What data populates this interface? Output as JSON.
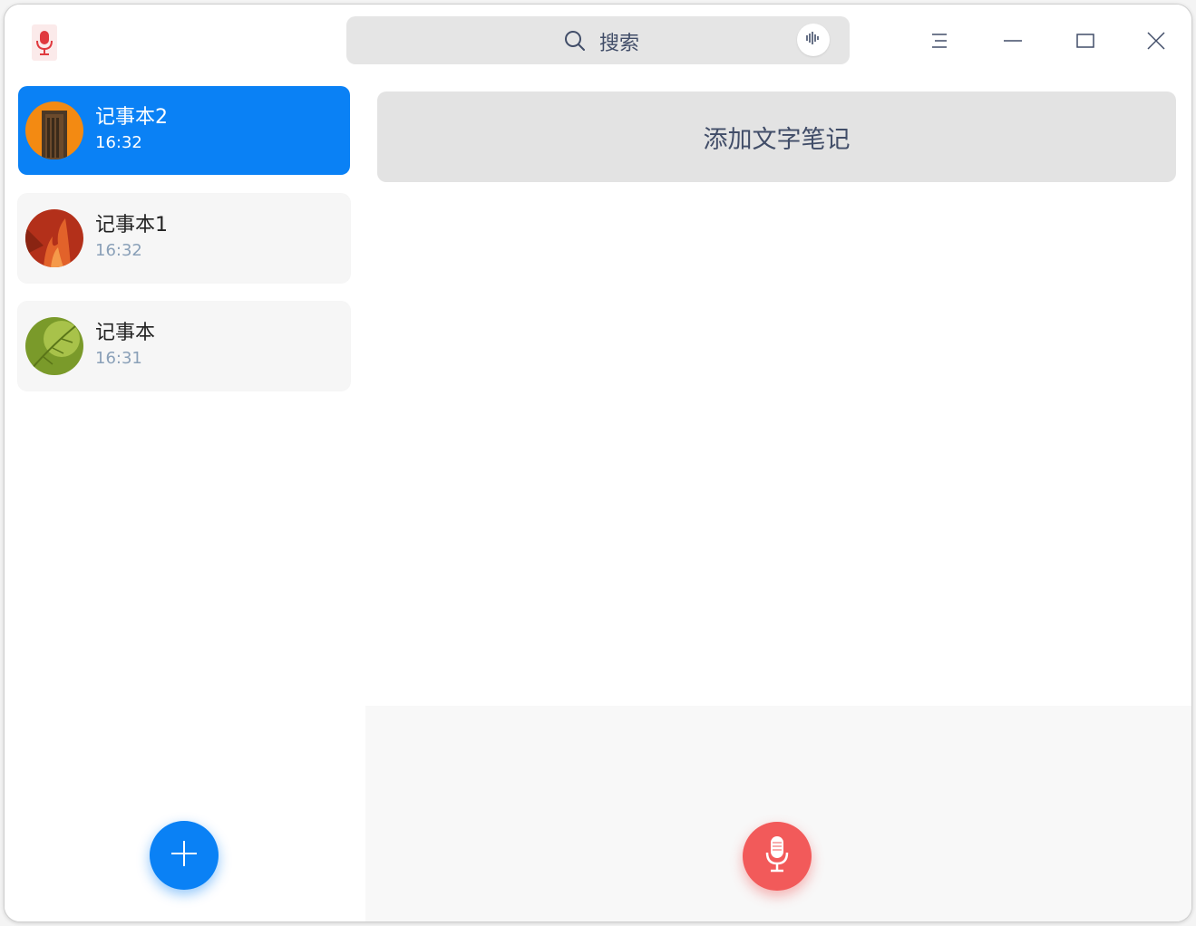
{
  "app": {
    "icon": "microphone-app-icon"
  },
  "search": {
    "placeholder": "搜索",
    "icon": "search-icon",
    "voice_icon": "waveform-icon"
  },
  "window_controls": {
    "menu_icon": "menu-icon",
    "minimize_icon": "minimize-icon",
    "maximize_icon": "maximize-icon",
    "close_icon": "close-icon"
  },
  "sidebar": {
    "notebooks": [
      {
        "name": "记事本2",
        "time": "16:32",
        "avatar": "door-avatar",
        "active": true
      },
      {
        "name": "记事本1",
        "time": "16:32",
        "avatar": "fire-avatar",
        "active": false
      },
      {
        "name": "记事本",
        "time": "16:31",
        "avatar": "leaf-avatar",
        "active": false
      }
    ],
    "add_icon": "plus-icon"
  },
  "main": {
    "add_text_note_label": "添加文字笔记",
    "record_icon": "microphone-icon"
  },
  "colors": {
    "accent": "#0a81f5",
    "record": "#f25a5a"
  }
}
